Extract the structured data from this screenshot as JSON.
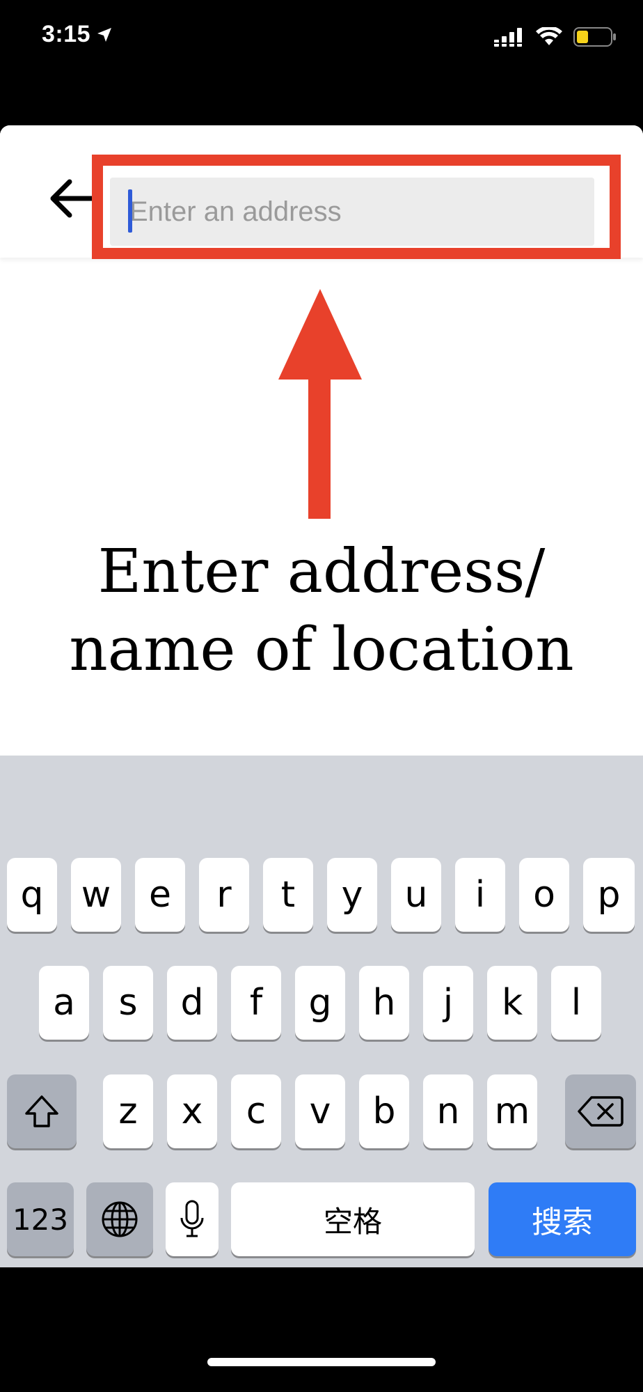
{
  "status_bar": {
    "time": "3:15",
    "location_icon": "location-arrow-icon",
    "signal_icon": "cellular-signal-icon",
    "wifi_icon": "wifi-icon",
    "battery_icon": "battery-icon",
    "battery_color": "#f5d21a"
  },
  "header": {
    "back_icon": "back-arrow-icon",
    "search_placeholder": "Enter an address",
    "search_value": ""
  },
  "annotation": {
    "line1": "Enter address/",
    "line2": "name of location",
    "color": "#e8412b"
  },
  "keyboard": {
    "row1": [
      "q",
      "w",
      "e",
      "r",
      "t",
      "y",
      "u",
      "i",
      "o",
      "p"
    ],
    "row2": [
      "a",
      "s",
      "d",
      "f",
      "g",
      "h",
      "j",
      "k",
      "l"
    ],
    "row3": [
      "z",
      "x",
      "c",
      "v",
      "b",
      "n",
      "m"
    ],
    "shift_icon": "shift-icon",
    "delete_icon": "backspace-icon",
    "numbers_label": "123",
    "globe_icon": "globe-icon",
    "mic_icon": "microphone-icon",
    "space_label": "空格",
    "search_label": "搜索",
    "search_key_color": "#2f7cf6"
  }
}
